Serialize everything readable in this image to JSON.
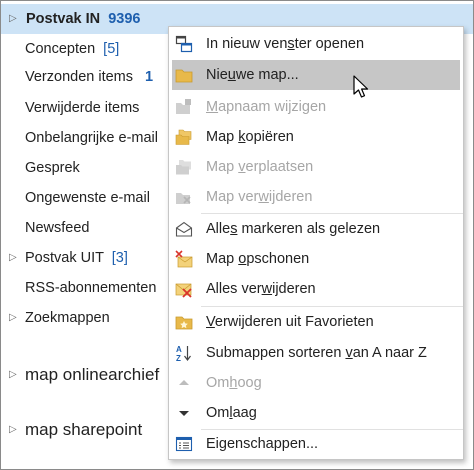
{
  "folders": {
    "inbox": {
      "label": "Postvak IN",
      "count": "9396"
    },
    "drafts": {
      "label": "Concepten",
      "count": "[5]"
    },
    "sent": {
      "label": "Verzonden items",
      "count": "1"
    },
    "deleted": {
      "label": "Verwijderde items"
    },
    "junk_email": {
      "label": "Onbelangrijke e-mail"
    },
    "conversation": {
      "label": "Gesprek"
    },
    "unwanted": {
      "label": "Ongewenste e-mail"
    },
    "newsfeed": {
      "label": "Newsfeed"
    },
    "outbox": {
      "label": "Postvak UIT",
      "count": "[3]"
    },
    "rss": {
      "label": "RSS-abonnementen"
    },
    "search": {
      "label": "Zoekmappen"
    },
    "archive": {
      "label": "map onlinearchief"
    },
    "sharepoint": {
      "label": "map sharepoint"
    }
  },
  "menu": {
    "open_new_window": {
      "pre": "In nieuw ven",
      "u": "s",
      "post": "ter openen",
      "icon": "new-window-icon"
    },
    "new_folder": {
      "pre": "Nie",
      "u": "u",
      "post": "we map...",
      "icon": "new-folder-icon"
    },
    "rename": {
      "pre": "",
      "u": "M",
      "post": "apnaam wijzigen",
      "icon": "rename-folder-icon"
    },
    "copy": {
      "pre": "Map ",
      "u": "k",
      "post": "opiëren",
      "icon": "copy-folder-icon"
    },
    "move": {
      "pre": "Map ",
      "u": "v",
      "post": "erplaatsen",
      "icon": "move-folder-icon"
    },
    "delete_folder": {
      "pre": "Map ver",
      "u": "w",
      "post": "ijderen",
      "icon": "delete-folder-icon"
    },
    "mark_read": {
      "pre": "Alle",
      "u": "s",
      "post": " markeren als gelezen",
      "icon": "envelope-open-icon"
    },
    "clean_up": {
      "pre": "Map ",
      "u": "o",
      "post": "pschonen",
      "icon": "cleanup-icon"
    },
    "delete_all": {
      "pre": "Alles ver",
      "u": "w",
      "post": "ijderen",
      "icon": "delete-all-icon"
    },
    "remove_favorites": {
      "pre": "",
      "u": "V",
      "post": "erwijderen uit Favorieten",
      "icon": "favorite-folder-icon"
    },
    "sort_az": {
      "pre": "Submappen sorteren ",
      "u": "v",
      "post": "an A naar Z",
      "icon": "sort-az-icon"
    },
    "move_up": {
      "pre": "Om",
      "u": "h",
      "post": "oog",
      "icon": "arrow-up-icon"
    },
    "move_down": {
      "pre": "Om",
      "u": "l",
      "post": "aag",
      "icon": "arrow-down-icon"
    },
    "properties": {
      "pre": "Eigenschappen",
      "u": "",
      "post": "...",
      "icon": "properties-icon"
    }
  },
  "colors": {
    "selected_bg": "#cde3f6",
    "hover_bg": "#c6c6c6",
    "count_blue": "#1e5fae",
    "disabled_text": "#a6a6a6",
    "folder_yellow": "#e8b94a"
  }
}
